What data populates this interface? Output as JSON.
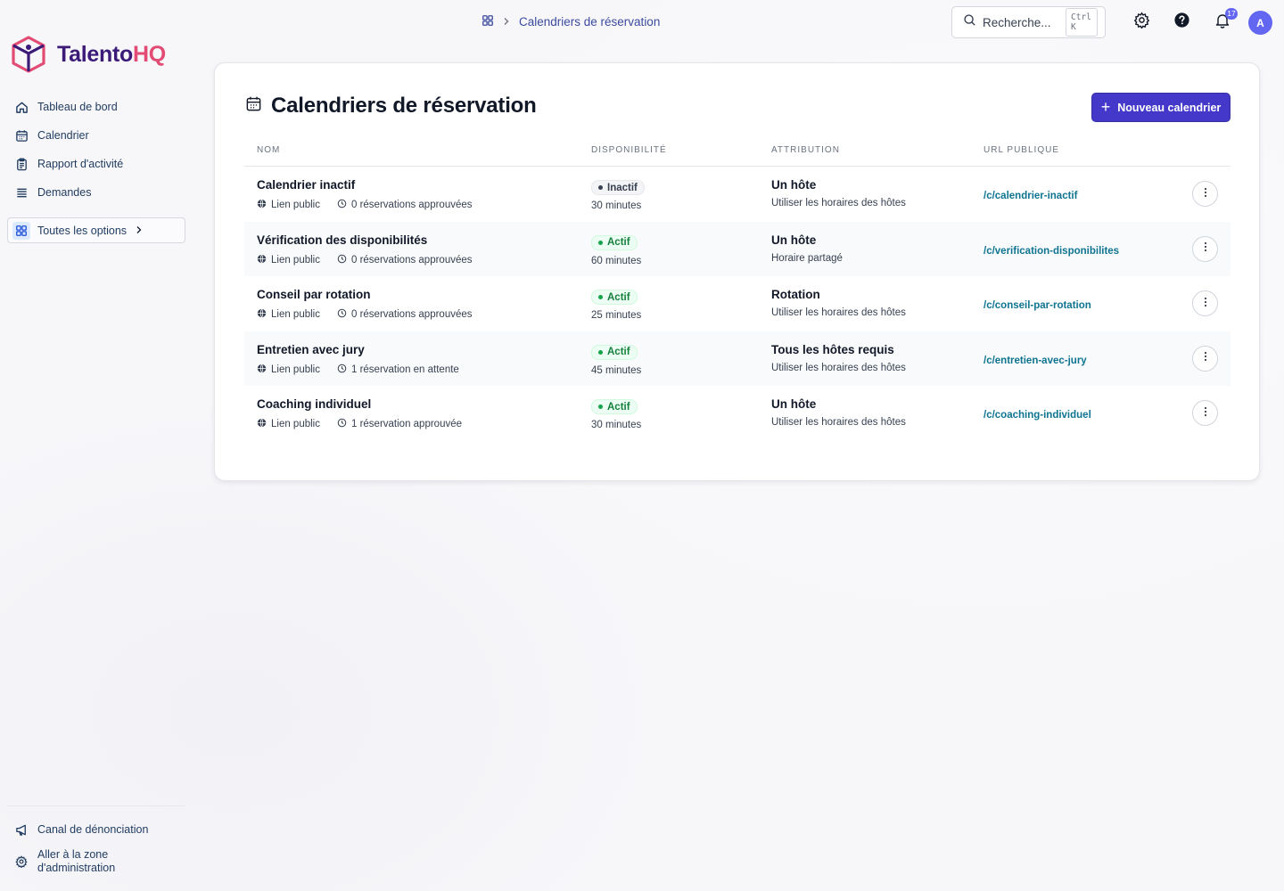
{
  "brand": {
    "name_main": "Talento",
    "name_accent": "HQ",
    "color_main": "#3b1a78",
    "color_accent": "#e24b73"
  },
  "sidebar": {
    "items": [
      {
        "label": "Tableau de bord",
        "icon": "home-icon"
      },
      {
        "label": "Calendrier",
        "icon": "calendar-icon"
      },
      {
        "label": "Rapport d'activité",
        "icon": "clipboard-icon"
      },
      {
        "label": "Demandes",
        "icon": "list-icon"
      }
    ],
    "all_options": {
      "label": "Toutes les options",
      "icon": "grid-icon"
    },
    "bottom": [
      {
        "label": "Canal de dénonciation",
        "icon": "megaphone-icon"
      },
      {
        "label": "Aller à la zone d'administration",
        "icon": "gear-icon"
      }
    ]
  },
  "topbar": {
    "breadcrumb": {
      "icon": "grid-icon",
      "current": "Calendriers de réservation"
    },
    "search": {
      "placeholder": "Recherche...",
      "shortcut": "Ctrl K"
    },
    "notifications_count": "17",
    "avatar_initial": "A"
  },
  "page": {
    "title": "Calendriers de réservation",
    "new_button": "Nouveau calendrier",
    "columns": [
      "Nom",
      "Disponibilité",
      "Attribution",
      "URL publique"
    ],
    "rows": [
      {
        "name": "Calendrier inactif",
        "link_label": "Lien public",
        "bookings": "0 réservations approuvées",
        "status": "Inactif",
        "status_kind": "inactive",
        "duration": "30 minutes",
        "attribution": "Un hôte",
        "schedule": "Utiliser les horaires des hôtes",
        "url": "/c/calendrier-inactif"
      },
      {
        "name": "Vérification des disponibilités",
        "link_label": "Lien public",
        "bookings": "0 réservations approuvées",
        "status": "Actif",
        "status_kind": "active",
        "duration": "60 minutes",
        "attribution": "Un hôte",
        "schedule": "Horaire partagé",
        "url": "/c/verification-disponibilites"
      },
      {
        "name": "Conseil par rotation",
        "link_label": "Lien public",
        "bookings": "0 réservations approuvées",
        "status": "Actif",
        "status_kind": "active",
        "duration": "25 minutes",
        "attribution": "Rotation",
        "schedule": "Utiliser les horaires des hôtes",
        "url": "/c/conseil-par-rotation"
      },
      {
        "name": "Entretien avec jury",
        "link_label": "Lien public",
        "bookings": "1 réservation en attente",
        "status": "Actif",
        "status_kind": "active",
        "duration": "45 minutes",
        "attribution": "Tous les hôtes requis",
        "schedule": "Utiliser les horaires des hôtes",
        "url": "/c/entretien-avec-jury"
      },
      {
        "name": "Coaching individuel",
        "link_label": "Lien public",
        "bookings": "1 réservation approuvée",
        "status": "Actif",
        "status_kind": "active",
        "duration": "30 minutes",
        "attribution": "Un hôte",
        "schedule": "Utiliser les horaires des hôtes",
        "url": "/c/coaching-individuel"
      }
    ]
  },
  "colors": {
    "primary": "#4338ca",
    "link": "#0e7490",
    "active": "#15803d"
  }
}
